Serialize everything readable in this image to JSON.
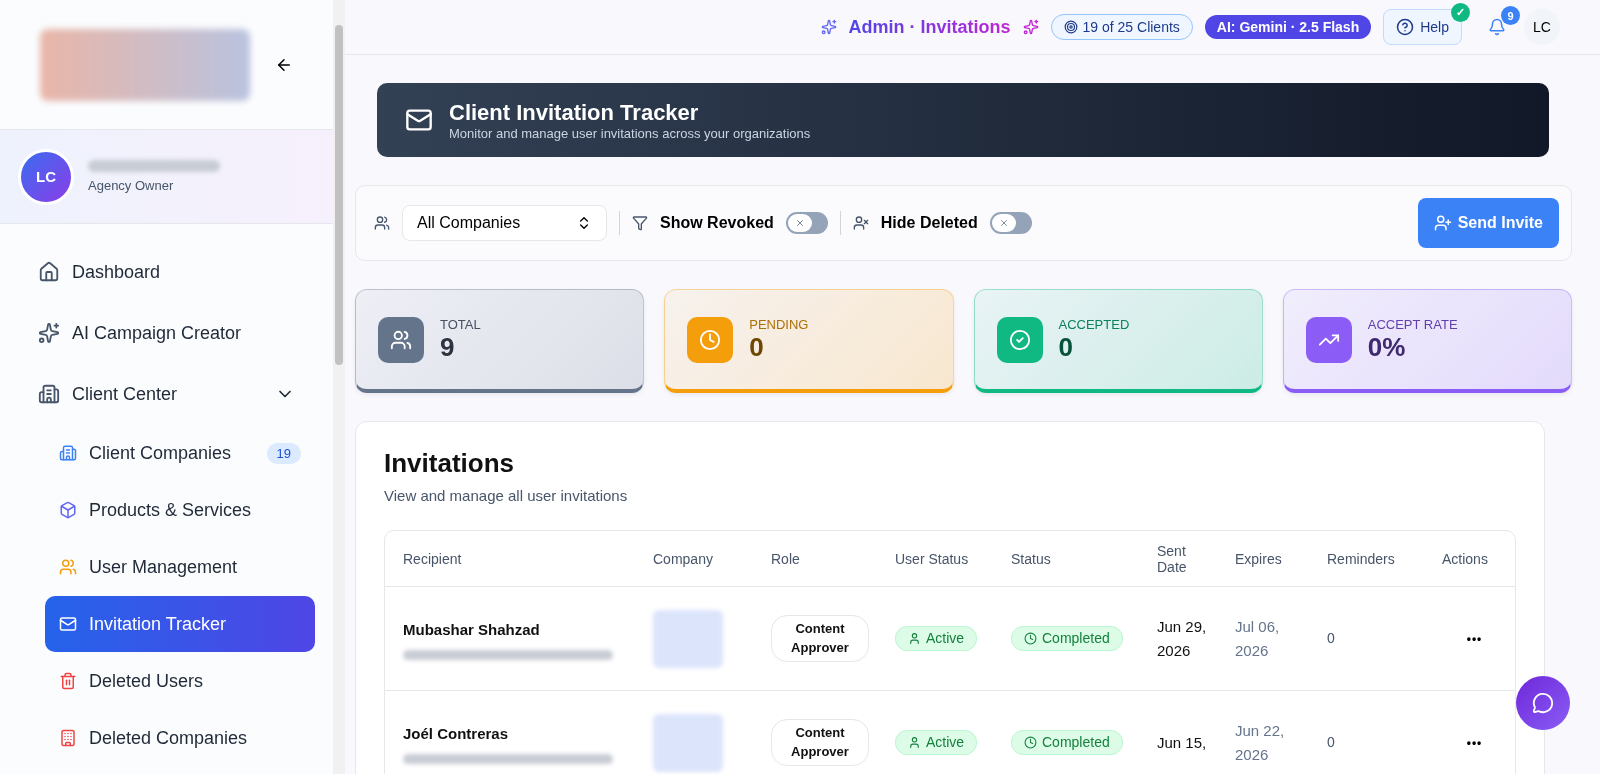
{
  "sidebar": {
    "user": {
      "initials": "LC",
      "role": "Agency Owner"
    },
    "items": [
      {
        "label": "Dashboard",
        "selected": false
      },
      {
        "label": "AI Campaign Creator",
        "selected": false
      },
      {
        "label": "Client Center",
        "selected": false,
        "expanded": true,
        "children": [
          {
            "label": "Client Companies",
            "selected": false,
            "badge": "19"
          },
          {
            "label": "Products & Services",
            "selected": false
          },
          {
            "label": "User Management",
            "selected": false
          },
          {
            "label": "Invitation Tracker",
            "selected": true
          },
          {
            "label": "Deleted Users",
            "selected": false
          },
          {
            "label": "Deleted Companies",
            "selected": false
          }
        ]
      }
    ]
  },
  "header": {
    "title": "Admin · Invitations",
    "clients": "19 of 25 Clients",
    "ai_model": "AI: Gemini · 2.5 Flash",
    "help": "Help",
    "help_ok": "✓",
    "notifications": "9",
    "user_initials": "LC"
  },
  "banner": {
    "title": "Client Invitation Tracker",
    "subtitle": "Monitor and manage user invitations across your organizations"
  },
  "filters": {
    "company": "All Companies",
    "toggles": [
      {
        "label": "Show Revoked",
        "on": false
      },
      {
        "label": "Hide Deleted",
        "on": false
      }
    ],
    "send": "Send Invite"
  },
  "stats": [
    {
      "label": "TOTAL",
      "value": "9",
      "color": "#64748b"
    },
    {
      "label": "PENDING",
      "value": "0",
      "color": "#f59e0b"
    },
    {
      "label": "ACCEPTED",
      "value": "0",
      "color": "#10b981"
    },
    {
      "label": "ACCEPT RATE",
      "value": "0%",
      "color": "#8b5cf6"
    }
  ],
  "invitations": {
    "title": "Invitations",
    "subtitle": "View and manage all user invitations",
    "columns": [
      "Recipient",
      "Company",
      "Role",
      "User Status",
      "Status",
      "Sent Date",
      "Expires",
      "Reminders",
      "Actions"
    ],
    "rows": [
      {
        "name": "Mubashar Shahzad",
        "role": "Content Approver",
        "user_status": "Active",
        "status": "Completed",
        "sent": "Jun 29, 2026",
        "expires": "Jul 06, 2026",
        "reminders": "0",
        "actions": "•••"
      },
      {
        "name": "Joél Contreras",
        "role": "Content Approver",
        "user_status": "Active",
        "status": "Completed",
        "sent": "Jun 15,",
        "expires": "Jun 22, 2026",
        "reminders": "0",
        "actions": "•••"
      }
    ]
  }
}
